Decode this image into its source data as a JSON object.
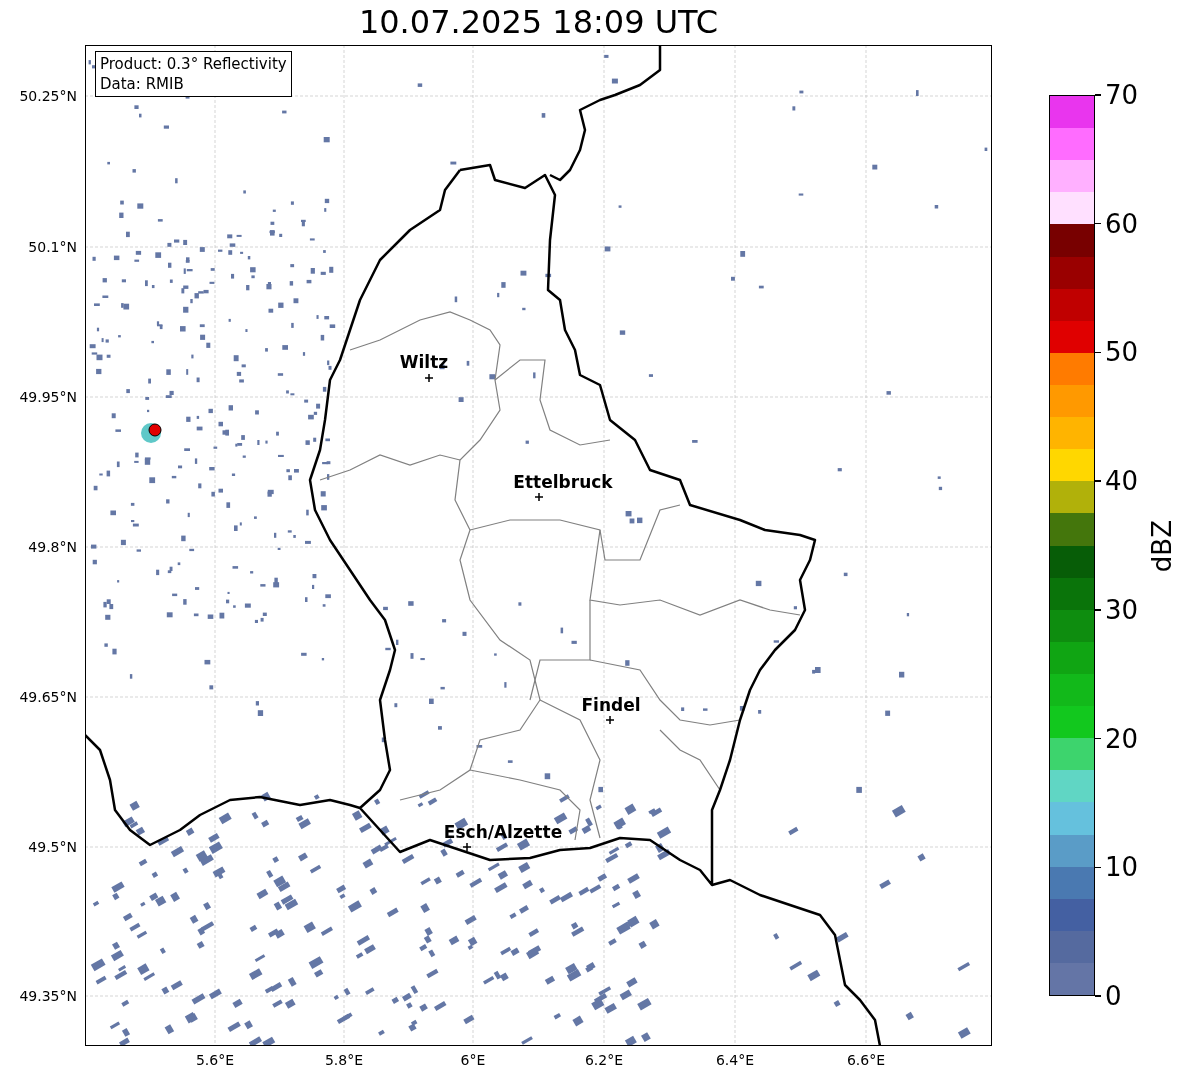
{
  "title": "10.07.2025 18:09 UTC",
  "legend": {
    "lines": [
      "Product: 0.3° Reflectivity",
      "Data: RMIB"
    ]
  },
  "map": {
    "x_ticks": [
      "5.6°E",
      "5.8°E",
      "6°E",
      "6.2°E",
      "6.4°E",
      "6.6°E"
    ],
    "y_ticks": [
      "50.25°N",
      "50.1°N",
      "49.95°N",
      "49.8°N",
      "49.65°N",
      "49.5°N",
      "49.35°N"
    ],
    "cities": [
      {
        "name": "Wiltz"
      },
      {
        "name": "Ettelbruck"
      },
      {
        "name": "Findel"
      },
      {
        "name": "Esch/Alzette"
      }
    ]
  },
  "colorbar": {
    "ticks": [
      "70",
      "60",
      "50",
      "40",
      "30",
      "20",
      "10",
      "0"
    ],
    "label": "dBZ",
    "bands": [
      {
        "color": "#e935ee"
      },
      {
        "color": "#ff6cff"
      },
      {
        "color": "#ffb0ff"
      },
      {
        "color": "#ffe0ff"
      },
      {
        "color": "#780000"
      },
      {
        "color": "#9a0000"
      },
      {
        "color": "#c00000"
      },
      {
        "color": "#e00000"
      },
      {
        "color": "#ff7b00"
      },
      {
        "color": "#ff9900"
      },
      {
        "color": "#ffb400"
      },
      {
        "color": "#ffd700"
      },
      {
        "color": "#b1b10a"
      },
      {
        "color": "#44760c"
      },
      {
        "color": "#075d07"
      },
      {
        "color": "#0a740a"
      },
      {
        "color": "#0e8d0f"
      },
      {
        "color": "#10a513"
      },
      {
        "color": "#12b91a"
      },
      {
        "color": "#12c81e"
      },
      {
        "color": "#3dd46d"
      },
      {
        "color": "#60d6c4"
      },
      {
        "color": "#65c1dd"
      },
      {
        "color": "#5a9cc7"
      },
      {
        "color": "#4a79b1"
      },
      {
        "color": "#4460a2"
      },
      {
        "color": "#556a9f"
      },
      {
        "color": "#6475a6"
      }
    ]
  }
}
